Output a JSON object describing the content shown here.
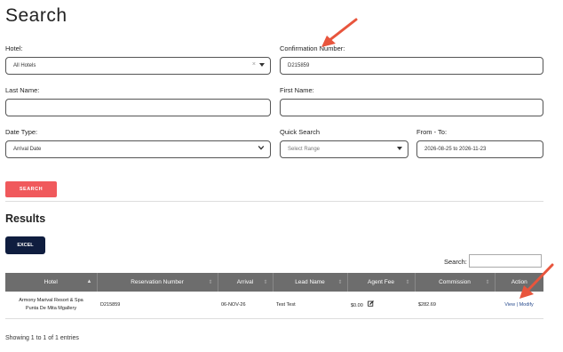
{
  "page": {
    "title": "Search"
  },
  "form": {
    "hotel": {
      "label": "Hotel:",
      "value": "All Hotels",
      "clear": "×"
    },
    "confirmation": {
      "label": "Confirmation Number:",
      "value": "D215859"
    },
    "last_name": {
      "label": "Last Name:",
      "value": ""
    },
    "first_name": {
      "label": "First Name:",
      "value": ""
    },
    "date_type": {
      "label": "Date Type:",
      "value": "Arrival Date"
    },
    "quick_search": {
      "label": "Quick Search",
      "placeholder": "Select Range"
    },
    "from_to": {
      "label": "From - To:",
      "value": "2026-08-25 to 2026-11-23"
    },
    "search_button": "SEARCH"
  },
  "results": {
    "heading": "Results",
    "excel_button": "EXCEL",
    "search_label": "Search:",
    "columns": [
      "Hotel",
      "Reservation Number",
      "Arrival",
      "Lead Name",
      "Agent Fee",
      "Commission",
      "Action"
    ],
    "rows": [
      {
        "hotel_line1": "Armony Marival Resort & Spa",
        "hotel_line2": "Punta De Mita Mgallery",
        "reservation": "D215859",
        "arrival": "06-NOV-26",
        "lead_name": "Test Test",
        "agent_fee": "$0.00",
        "commission": "$282.69",
        "action_view": "View",
        "action_sep": " | ",
        "action_modify": "Modify"
      }
    ],
    "footer": "Showing 1 to 1 of 1 entries"
  },
  "colors": {
    "search_button": "#f0595c",
    "excel_button": "#0f1d3f",
    "table_header": "#6d6d6d",
    "arrow": "#e8553d"
  }
}
